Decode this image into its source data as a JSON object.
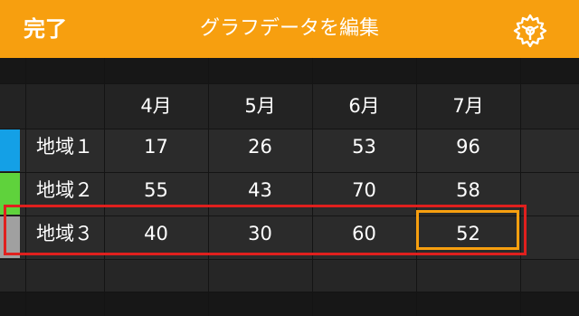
{
  "topbar": {
    "done_label": "完了",
    "title": "グラフデータを編集",
    "settings_icon": "gear-icon"
  },
  "table": {
    "columns": [
      "4月",
      "5月",
      "6月",
      "7月"
    ],
    "rows": [
      {
        "label": "地域１",
        "color": "#14a0e6",
        "values": [
          "17",
          "26",
          "53",
          "96"
        ]
      },
      {
        "label": "地域２",
        "color": "#5fd23c",
        "values": [
          "55",
          "43",
          "70",
          "58"
        ]
      },
      {
        "label": "地域３",
        "color": "#a0a0a0",
        "values": [
          "40",
          "30",
          "60",
          "52"
        ]
      }
    ],
    "selected_row": 2,
    "selected_col": 3
  },
  "colors": {
    "accent": "#f79f0f",
    "row_highlight": "#e0201e",
    "background": "#1f1f1f"
  }
}
